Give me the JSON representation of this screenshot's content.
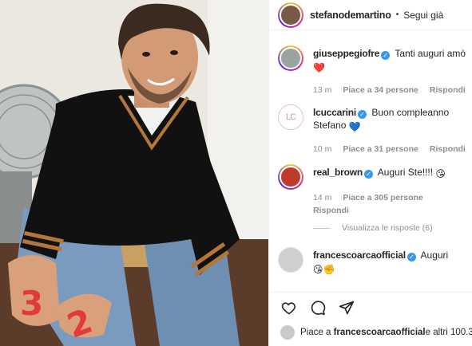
{
  "post": {
    "author": "stefanodemartino",
    "separator": "•",
    "follow_label": "Segui già"
  },
  "comments": [
    {
      "username": "giuseppegiofre",
      "verified": true,
      "text": "Tanti auguri amò",
      "emoji": "❤️",
      "time": "13 m",
      "likes": "Piace a 34 persone",
      "reply": "Rispondi"
    },
    {
      "username": "lcuccarini",
      "verified": true,
      "text": "Buon compleanno Stefano",
      "emoji": "💙",
      "time": "10 m",
      "likes": "Piace a 31 persone",
      "reply": "Rispondi"
    },
    {
      "username": "real_brown",
      "verified": true,
      "text": "Auguri Ste!!!!",
      "emoji": "😘",
      "time": "14 m",
      "likes": "Piace a 305 persone",
      "reply": "Rispondi"
    },
    {
      "username": "francescoarcaofficial",
      "verified": true,
      "text": "Auguri",
      "emoji": "😘✊",
      "time": "",
      "likes": "",
      "reply": ""
    }
  ],
  "view_replies": "Visualizza le risposte (6)",
  "footer": {
    "likes_prefix": "Piace a ",
    "likes_user": "francescoarcaofficial",
    "likes_suffix": " e altri 100.3"
  },
  "icons": {
    "like": "heart-icon",
    "comment": "comment-icon",
    "share": "paper-plane-icon"
  }
}
